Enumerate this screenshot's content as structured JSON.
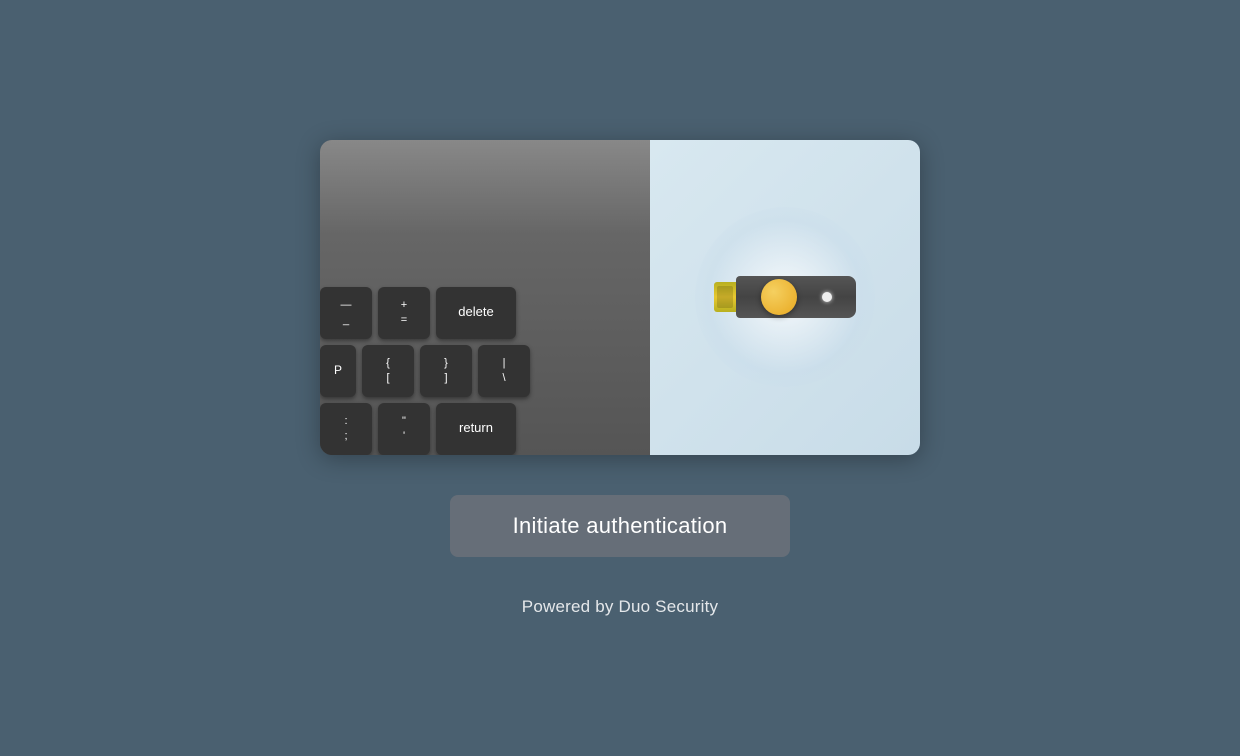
{
  "page": {
    "background_color": "#4a6070"
  },
  "illustration": {
    "alt": "Security key authentication illustration"
  },
  "keyboard": {
    "row1": [
      {
        "top": "—",
        "bottom": "_",
        "chars": "—\n_"
      },
      {
        "top": "+",
        "bottom": "=",
        "chars": "+\n="
      },
      {
        "chars": "delete",
        "wide": true
      }
    ],
    "row2": [
      {
        "chars": "P",
        "partial": true
      },
      {
        "top": "{",
        "bottom": "[",
        "chars": "{\n["
      },
      {
        "top": "}",
        "bottom": "]",
        "chars": "}\n]"
      },
      {
        "top": "|",
        "bottom": "\\",
        "chars": "|\n\\"
      }
    ],
    "row3": [
      {
        "top": ":",
        "bottom": ";",
        "chars": ":\n;"
      },
      {
        "top": "\"",
        "bottom": "'",
        "chars": "\"\n'"
      },
      {
        "chars": "return",
        "wide": true
      }
    ]
  },
  "auth_button": {
    "label": "Initiate authentication"
  },
  "footer": {
    "text": "Powered by Duo Security"
  }
}
